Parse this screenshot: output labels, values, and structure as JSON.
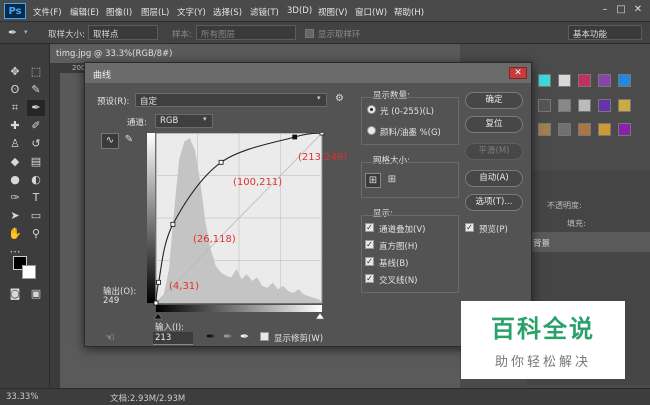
{
  "app": {
    "logo": "Ps"
  },
  "menu": [
    "文件(F)",
    "编辑(E)",
    "图像(I)",
    "图层(L)",
    "文字(Y)",
    "选择(S)",
    "滤镜(T)",
    "3D(D)",
    "视图(V)",
    "窗口(W)",
    "帮助(H)"
  ],
  "options_bar": {
    "sample_size_label": "取样大小:",
    "sample_size_value": "取样点",
    "sample_label": "样本:",
    "sample_value": "所有图层",
    "show_ring_label": "显示取样环",
    "workspace": "基本功能"
  },
  "document": {
    "tab_title": "timg.jpg @ 33.3%(RGB/8#)",
    "ruler_zero": "200",
    "zoom": "33.33%",
    "doc_size": "文档:2.93M/2.93M"
  },
  "panels": {
    "tab_paths": "路径",
    "opacity_label": "不透明度:",
    "fill_label": "填充:",
    "layer_name": "背景"
  },
  "curves_dialog": {
    "title": "曲线",
    "preset_label": "预设(R):",
    "preset_value": "自定",
    "channel_label": "通道:",
    "channel_value": "RGB",
    "output_label": "输出(O):",
    "output_value": "249",
    "input_label": "输入(I):",
    "input_value": "213",
    "show_clipping_label": "显示修剪(W)",
    "display_amount_label": "显示数量:",
    "light_label": "光 (0-255)(L)",
    "pigment_label": "颜料/油墨 %(G)",
    "grid_size_label": "网格大小:",
    "show_label": "显示:",
    "channel_overlay_label": "通道叠加(V)",
    "histogram_label": "直方图(H)",
    "baseline_label": "基线(B)",
    "intersection_label": "交叉线(N)",
    "btn_ok": "确定",
    "btn_reset": "复位",
    "btn_smooth": "平滑(M)",
    "btn_auto": "自动(A)",
    "btn_options": "选项(T)...",
    "preview_label": "预览(P)",
    "points": [
      {
        "label": "(4,31)",
        "in": 4,
        "out": 31
      },
      {
        "label": "(26,118)",
        "in": 26,
        "out": 118
      },
      {
        "label": "(100,211)",
        "in": 100,
        "out": 211
      },
      {
        "label": "(213,249)",
        "in": 213,
        "out": 249
      }
    ]
  },
  "watermark": {
    "line1": "百科全说",
    "line2": "助你轻松解决"
  }
}
